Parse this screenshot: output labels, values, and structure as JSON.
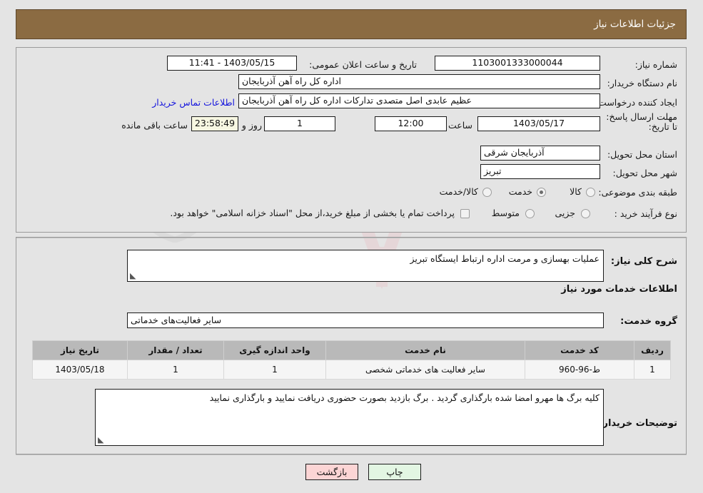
{
  "header": {
    "title": "جزئیات اطلاعات نیاز"
  },
  "top": {
    "need_number_label": "شماره نیاز:",
    "need_number_value": "1103001333000044",
    "buyer_org_label": "نام دستگاه خریدار:",
    "buyer_org_value": "اداره کل راه آهن آذربایجان",
    "creator_label": "ایجاد کننده درخواست:",
    "creator_value": "عظیم عابدی اصل متصدی تدارکات اداره کل راه آهن آذربایجان",
    "deadline_label": "مهلت ارسال پاسخ: تا تاریخ:",
    "deadline_date": "1403/05/17",
    "hour_label": "ساعت",
    "deadline_time": "12:00",
    "days_value": "1",
    "days_label": "روز و",
    "countdown_value": "23:58:49",
    "countdown_label": "ساعت باقی مانده",
    "announce_label": "تاریخ و ساعت اعلان عمومی:",
    "announce_value": "1403/05/15 - 11:41",
    "contact_link": "اطلاعات تماس خریدار",
    "province_label": "استان محل تحویل:",
    "province_value": "آذربایجان شرقی",
    "city_label": "شهر محل تحویل:",
    "city_value": "تبریز",
    "category_label": "طبقه بندی موضوعی:",
    "category_options": [
      {
        "label": "کالا",
        "selected": false
      },
      {
        "label": "خدمت",
        "selected": true
      },
      {
        "label": "کالا/خدمت",
        "selected": false
      }
    ],
    "process_label": "نوع فرآیند خرید :",
    "process_options": [
      {
        "label": "جزیی",
        "selected": false
      },
      {
        "label": "متوسط",
        "selected": false
      }
    ],
    "treasury_checkbox_checked": false,
    "treasury_text": "پرداخت تمام یا بخشی از مبلغ خرید،از محل \"اسناد خزانه اسلامی\" خواهد بود."
  },
  "mid": {
    "general_desc_label": "شرح کلی نیاز:",
    "general_desc_value": "عملیات بهسازی و مرمت اداره ارتباط ایستگاه تبریز",
    "services_heading": "اطلاعات خدمات مورد نیاز",
    "service_group_label": "گروه خدمت:",
    "service_group_value": "سایر فعالیت‌های خدماتی",
    "buyer_notes_label": "توضیحات خریدار:",
    "buyer_notes_value": "کلیه برگ ها مهرو امضا شده بارگذاری گردید . برگ بازدید بصورت حضوری دریافت نمایید و بارگذاری نمایید"
  },
  "table": {
    "headers": [
      "ردیف",
      "کد خدمت",
      "نام خدمت",
      "واحد اندازه گیری",
      "تعداد / مقدار",
      "تاریخ نیاز"
    ],
    "rows": [
      {
        "row": "1",
        "code": "ط-96-960",
        "name": "سایر فعالیت های خدماتی شخصی",
        "unit": "1",
        "qty": "1",
        "date": "1403/05/18"
      }
    ]
  },
  "footer": {
    "print_label": "چاپ",
    "back_label": "بازگشت"
  },
  "watermark": {
    "text": "AriaTender.net"
  },
  "colors": {
    "header_bg": "#8b6b42",
    "link": "#1414dd",
    "back_btn": "#fcd5d5",
    "print_btn": "#e3f6e3",
    "countdown_bg": "#f7f7e2"
  }
}
